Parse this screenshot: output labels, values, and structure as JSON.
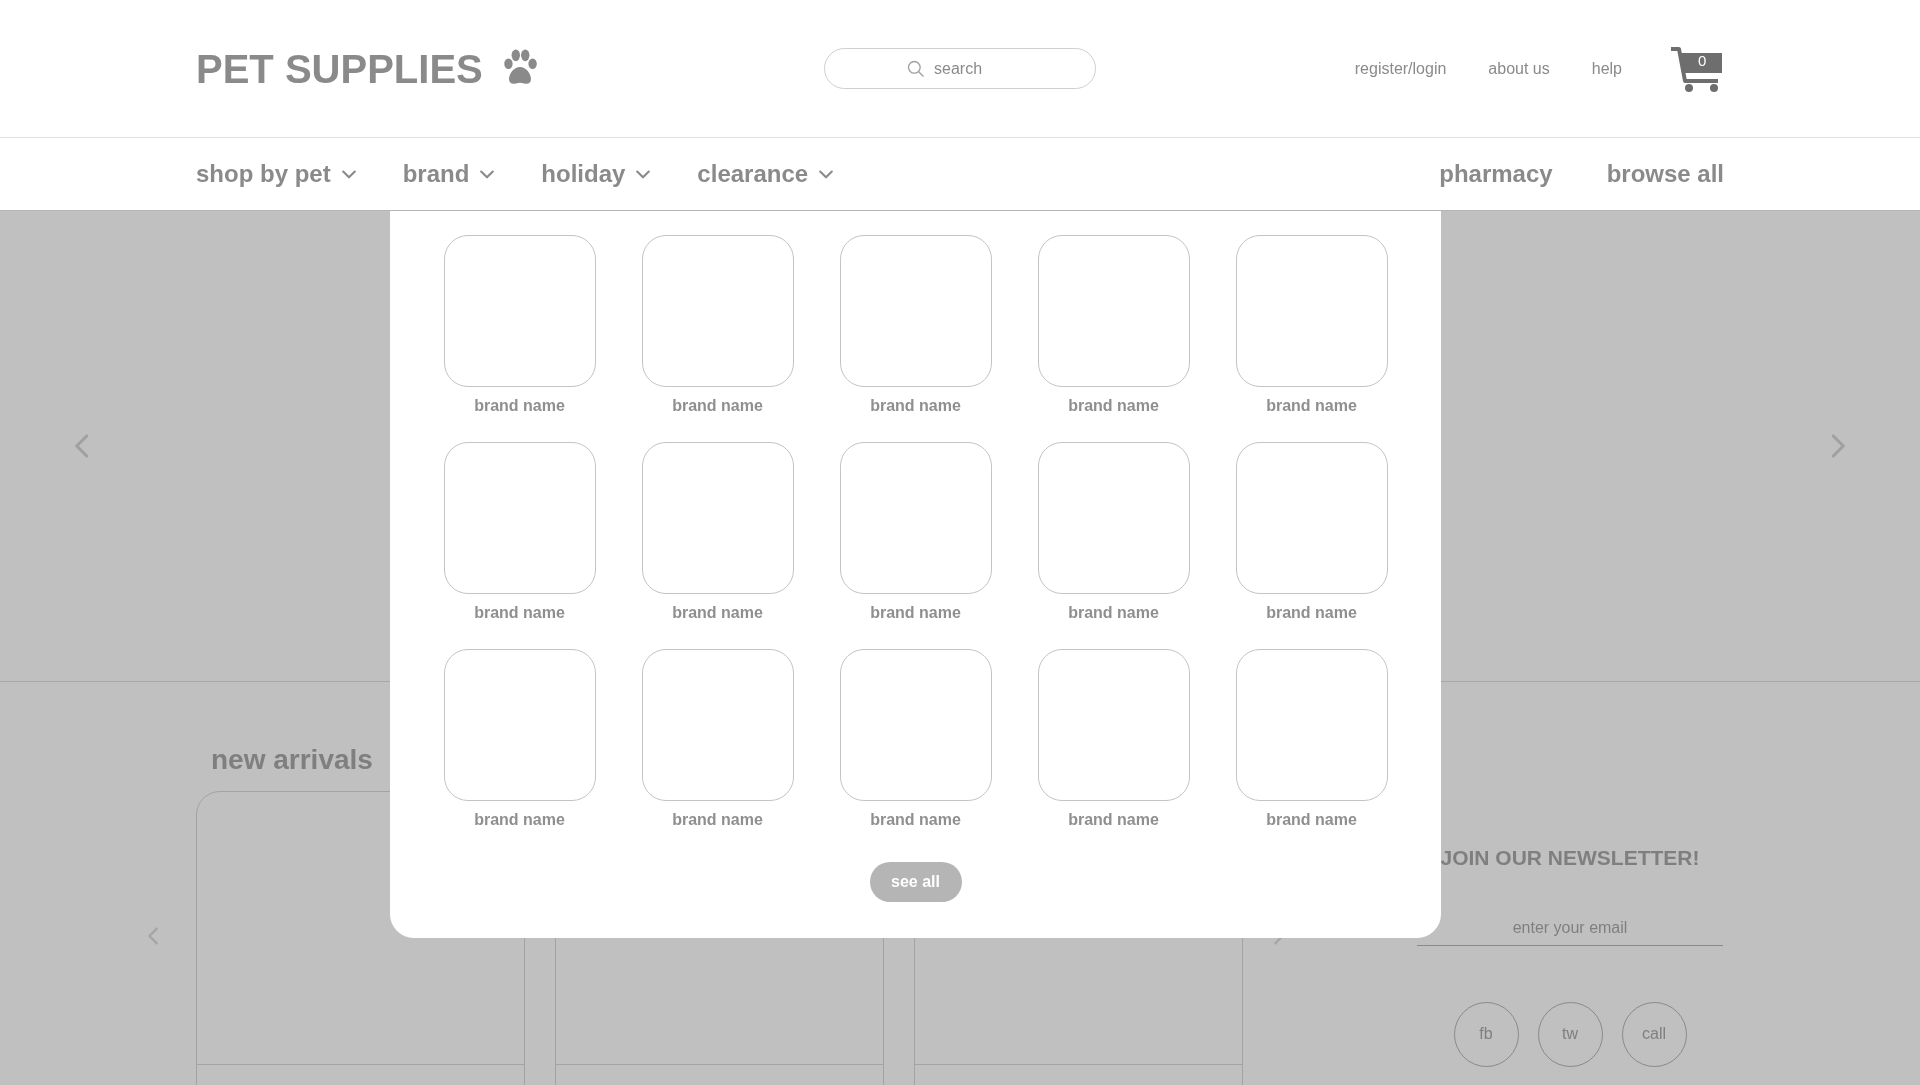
{
  "header": {
    "logo": "PET SUPPLIES",
    "search": {
      "placeholder": "search"
    },
    "links": [
      "register/login",
      "about us",
      "help"
    ],
    "cart_count": "0"
  },
  "nav": {
    "menus": [
      "shop by pet",
      "brand",
      "holiday",
      "clearance"
    ],
    "links": [
      "pharmacy",
      "browse all"
    ]
  },
  "brand_menu": {
    "brands": [
      "brand name",
      "brand name",
      "brand name",
      "brand name",
      "brand name",
      "brand name",
      "brand name",
      "brand name",
      "brand name",
      "brand name",
      "brand name",
      "brand name",
      "brand name",
      "brand name",
      "brand name"
    ],
    "see_all": "see all"
  },
  "new_arrivals": {
    "title": "new arrivals"
  },
  "newsletter": {
    "title": "JOIN OUR NEWSLETTER!",
    "email": {
      "placeholder": "enter your email"
    },
    "social": [
      "fb",
      "tw",
      "call"
    ]
  }
}
